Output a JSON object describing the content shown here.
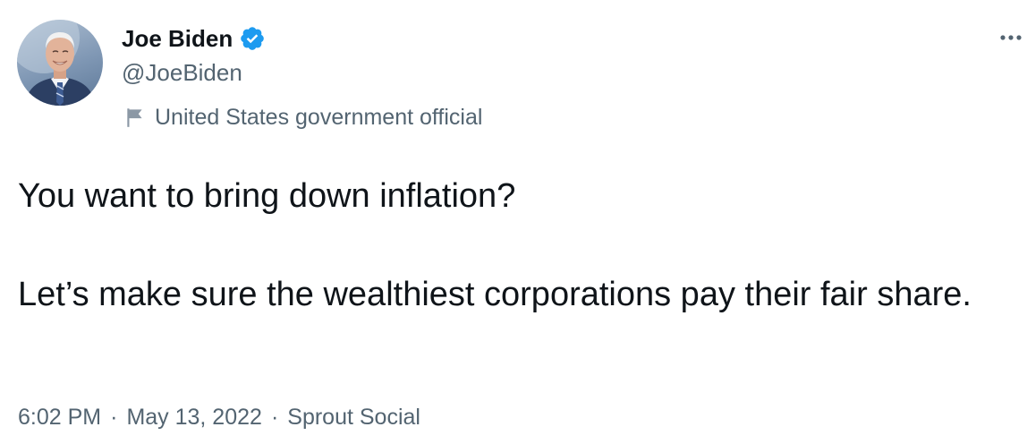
{
  "author": {
    "display_name": "Joe Biden",
    "handle": "@JoeBiden",
    "verified": true,
    "avatar": "profile-photo",
    "label": "United States government official",
    "label_icon": "flag-icon"
  },
  "menu": {
    "more_icon": "ellipsis-icon"
  },
  "tweet": {
    "paragraph_1": "You want to bring down inflation?",
    "paragraph_2": "Let’s make sure the wealthiest corporations pay their fair share."
  },
  "meta": {
    "time": "6:02 PM",
    "separator": "·",
    "date": "May 13, 2022",
    "source": "Sprout Social"
  },
  "colors": {
    "text_primary": "#0f1419",
    "text_secondary": "#536471",
    "verified_badge": "#1d9bf0"
  }
}
